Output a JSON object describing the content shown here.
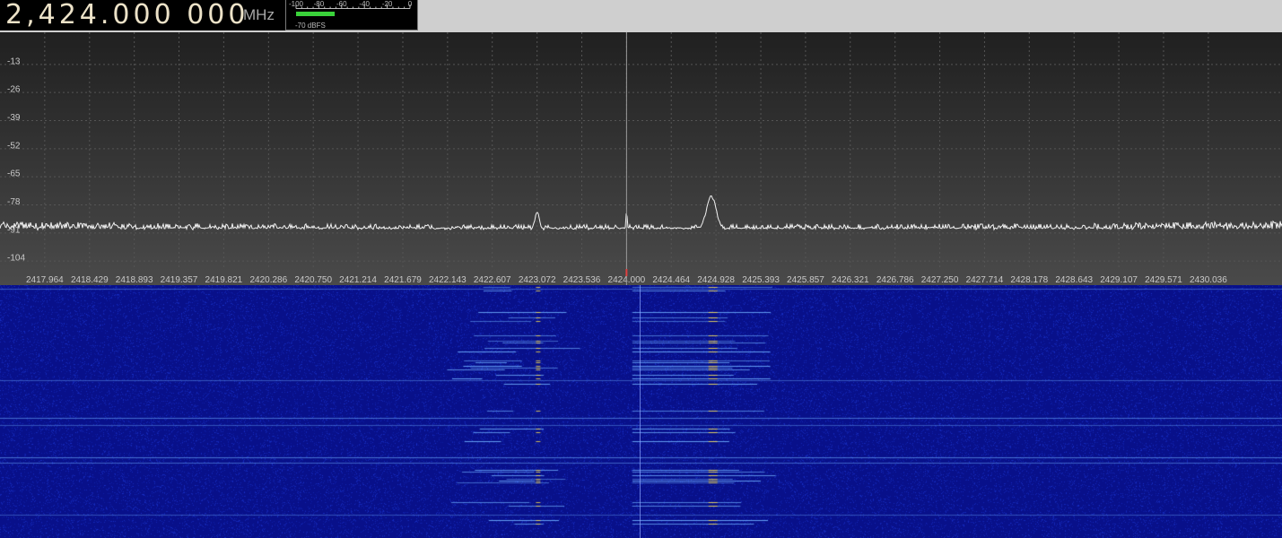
{
  "frequency": {
    "value": "2,424.000 000",
    "unit": "MHz"
  },
  "smeter": {
    "scale": [
      "-100",
      "-80",
      "-60",
      "-40",
      "-20",
      "0"
    ],
    "scale_min": -100,
    "scale_max": 0,
    "level_dbfs": -70,
    "readout": "-70 dBFS"
  },
  "spectrum": {
    "y_labels": [
      "-13",
      "-26",
      "-39",
      "-52",
      "-65",
      "-78",
      "-91",
      "-104"
    ],
    "y_range": [
      -117,
      0
    ],
    "x_labels": [
      "2417.964",
      "2418.429",
      "2418.893",
      "2419.357",
      "2419.821",
      "2420.286",
      "2420.750",
      "2421.214",
      "2421.679",
      "2422.143",
      "2422.607",
      "2423.072",
      "2423.536",
      "2424.000",
      "2424.464",
      "2424.928",
      "2425.393",
      "2425.857",
      "2426.321",
      "2426.786",
      "2427.250",
      "2427.714",
      "2428.178",
      "2428.643",
      "2429.107",
      "2429.571",
      "2430.036"
    ],
    "x_range_mhz": [
      2417.5,
      2430.8
    ],
    "center_mhz": 2424.0,
    "noise_floor_dbfs": -91,
    "peaks": [
      {
        "mhz": 2423.072,
        "dbfs": -83
      },
      {
        "mhz": 2424.0,
        "dbfs": -82
      },
      {
        "mhz": 2424.88,
        "dbfs": -76
      }
    ],
    "colors": {
      "trace": "#f2f2f2",
      "grid": "#555555",
      "label": "#c9c9c9",
      "center_line": "#9a9a9a",
      "tick_mark": "#e04040"
    }
  },
  "waterfall": {
    "colors": {
      "background": "#08108a",
      "noise": "#1d39d8",
      "mid": "#6fb0ff",
      "hot": "#ffe24a"
    }
  }
}
